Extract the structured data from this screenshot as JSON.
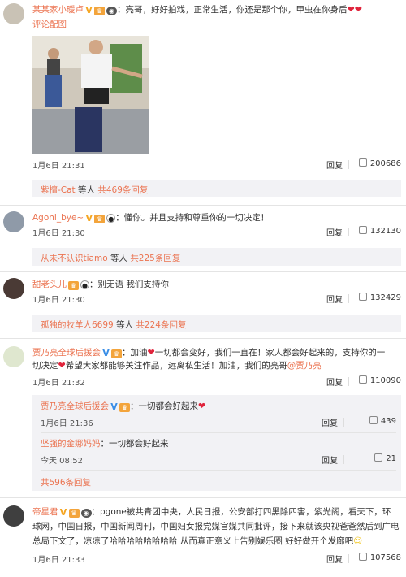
{
  "comments": [
    {
      "name": "某某家小暖卢",
      "text": "：亮哥，好好拍戏，正常生活，你还是那个你，甲虫在你身后",
      "link": "评论配图",
      "time": "1月6日 21:31",
      "reply_label": "回复",
      "likes": "200686",
      "replies_by": "紫檀-Cat",
      "replies_mid": "等人",
      "replies_count": "共469条回复"
    },
    {
      "name": "Agoni_bye~",
      "text": "：懂你。并且支持和尊重你的一切决定！",
      "time": "1月6日 21:30",
      "reply_label": "回复",
      "likes": "132130",
      "replies_by": "从未不认识tiamo",
      "replies_mid": "等人",
      "replies_count": "共225条回复"
    },
    {
      "name": "甜老头儿",
      "text": "：别无语 我们支持你",
      "time": "1月6日 21:30",
      "reply_label": "回复",
      "likes": "132429",
      "replies_by": "孤独的牧羊人6699",
      "replies_mid": "等人",
      "replies_count": "共224条回复"
    },
    {
      "name": "贾乃亮全球后援会",
      "text_a": "：加油",
      "text_b": "一切都会变好，我们一直在！家人都会好起来的，支持你的一",
      "text_c": "切决定",
      "text_d": "希望大家都能够关注作品，远离私生活！加油，我们的亮哥",
      "mention": "@贾乃亮",
      "time": "1月6日 21:32",
      "reply_label": "回复",
      "likes": "110090",
      "subreplies": [
        {
          "name": "贾乃亮全球后援会",
          "text": "：一切都会好起来",
          "time": "1月6日 21:36",
          "reply_label": "回复",
          "likes": "439"
        },
        {
          "name": "坚强的金娜妈妈",
          "text": "：一切都会好起来",
          "time": "今天 08:52",
          "reply_label": "回复",
          "likes": "21"
        }
      ],
      "replies_count": "共596条回复"
    },
    {
      "name": "帝星君",
      "text_a": "：pgone被共青团中央，人民日报，公安部打四黑除四害，紫光阁，看天下，环",
      "text_b": "球网，中国日报，中国新闻周刊，中国妇女报党媒官媒共同批评，接下来就该央视爸爸然后到广电",
      "text_c": "总局下文了，凉凉了哈哈哈哈哈哈哈哈 从而真正意义上告别娱乐圈 好好做开个发廊吧",
      "time": "1月6日 21:33",
      "reply_label": "回复",
      "likes": "107568"
    }
  ],
  "colors": {
    "accent": "#eb7350",
    "reply_bg": "#f2f2f5",
    "heart": "#e0233b"
  },
  "icons": [
    "vip-v-icon",
    "level-badge-icon",
    "panda-icon",
    "heart-icon",
    "thumbs-up-icon"
  ]
}
